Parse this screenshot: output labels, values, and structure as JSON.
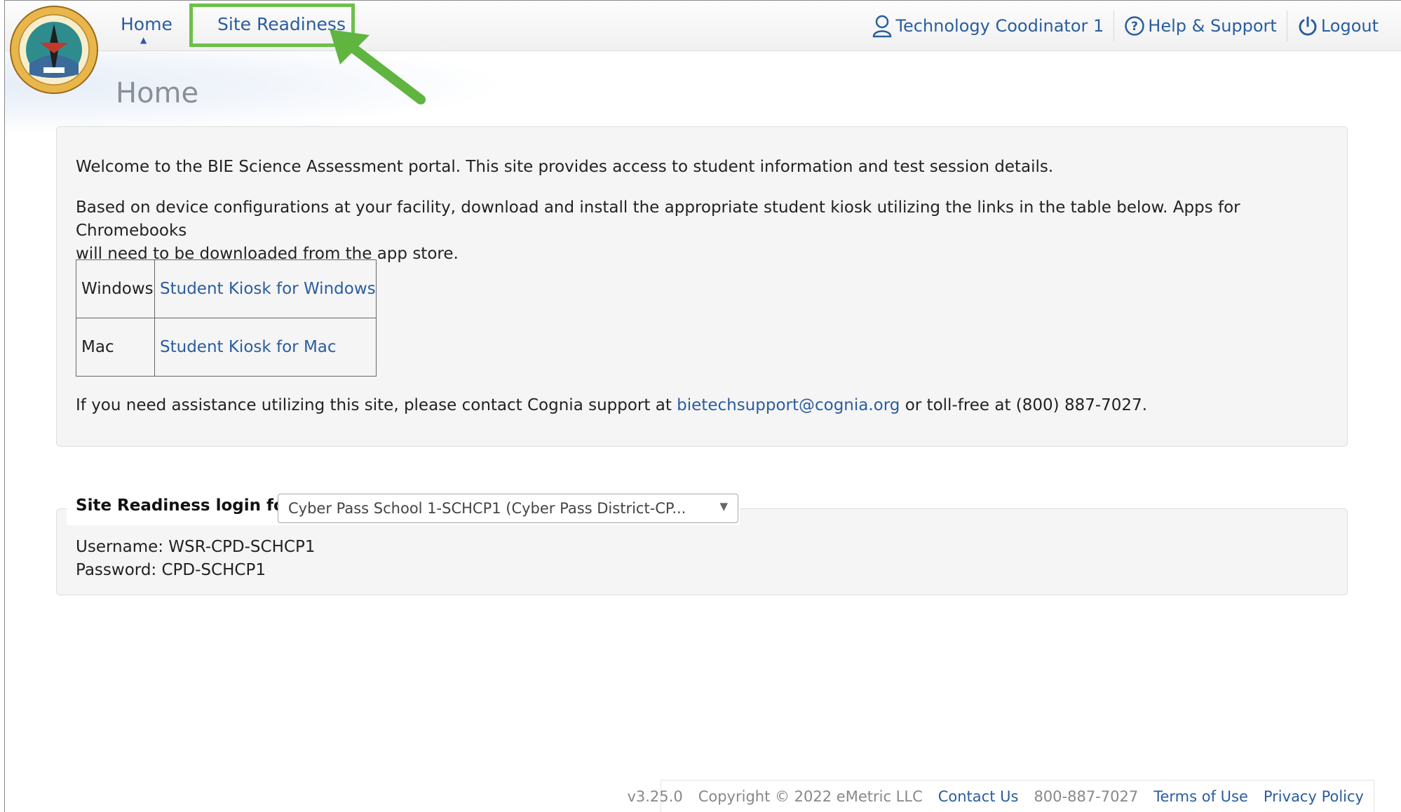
{
  "header": {
    "logo_alt": "Bureau of Indian Education",
    "nav": {
      "home": "Home",
      "site_readiness": "Site Readiness"
    },
    "user_name": "Technology Coodinator 1",
    "help": "Help & Support",
    "logout": "Logout"
  },
  "page_title": "Home",
  "welcome": {
    "intro": "Welcome to the BIE Science Assessment portal. This site provides access to student information and test session details.",
    "download_line1": "Based on device configurations at your facility, download and install the appropriate student kiosk utilizing the links in the table below. Apps for Chromebooks",
    "download_line2": "will need to be downloaded from the app store.",
    "kiosk_table": [
      {
        "os": "Windows",
        "link": "Student Kiosk for Windows"
      },
      {
        "os": "Mac",
        "link": "Student Kiosk for Mac"
      }
    ],
    "assist_prefix": "If you need assistance utilizing this site, please contact Cognia support at ",
    "assist_email": "bietechsupport@cognia.org",
    "assist_suffix": " or toll-free at (800) 887-7027."
  },
  "site_readiness": {
    "label": "Site Readiness login for",
    "selected_school": "Cyber Pass School 1-SCHCP1 (Cyber Pass District-CP...",
    "username": "Username: WSR-CPD-SCHCP1",
    "password": "Password: CPD-SCHCP1"
  },
  "footer": {
    "version": "v3.25.0",
    "copyright": "Copyright © 2022 eMetric LLC",
    "contact": "Contact Us",
    "phone": "800-887-7027",
    "terms": "Terms of Use",
    "privacy": "Privacy Policy"
  },
  "colors": {
    "link": "#2a5d9f",
    "highlight": "#6cc04a",
    "panel_bg": "#f5f5f5",
    "title_gray": "#8a8f96"
  }
}
